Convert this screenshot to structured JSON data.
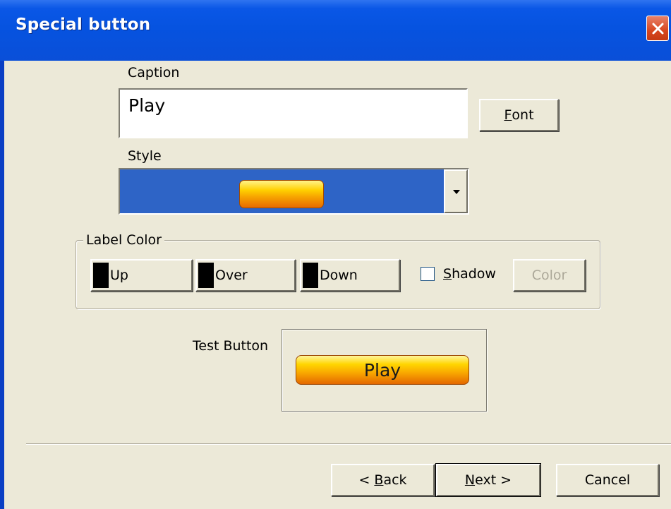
{
  "window": {
    "title": "Special button"
  },
  "caption": {
    "label": "Caption",
    "value": "Play",
    "font_button_prefix": "",
    "font_button_mnemonic": "F",
    "font_button_rest": "ont"
  },
  "style": {
    "label": "Style"
  },
  "label_color": {
    "legend": "Label Color",
    "up": "Up",
    "over": "Over",
    "down": "Down",
    "shadow_mnemonic": "S",
    "shadow_rest": "hadow",
    "color_button": "Color",
    "swatch_color": "#000000",
    "shadow_checked": false
  },
  "test": {
    "label": "Test Button",
    "button_text": "Play"
  },
  "footer": {
    "back_prefix": "< ",
    "back_mnemonic": "B",
    "back_rest": "ack",
    "next_mnemonic": "N",
    "next_rest": "ext >",
    "cancel": "Cancel"
  },
  "colors": {
    "titlebar": "#0a57e6",
    "face": "#ece9d8",
    "combo_bg": "#2e64c6",
    "close": "#d8461f"
  },
  "icons": {
    "close": "close-icon",
    "dropdown": "chevron-down-icon"
  }
}
